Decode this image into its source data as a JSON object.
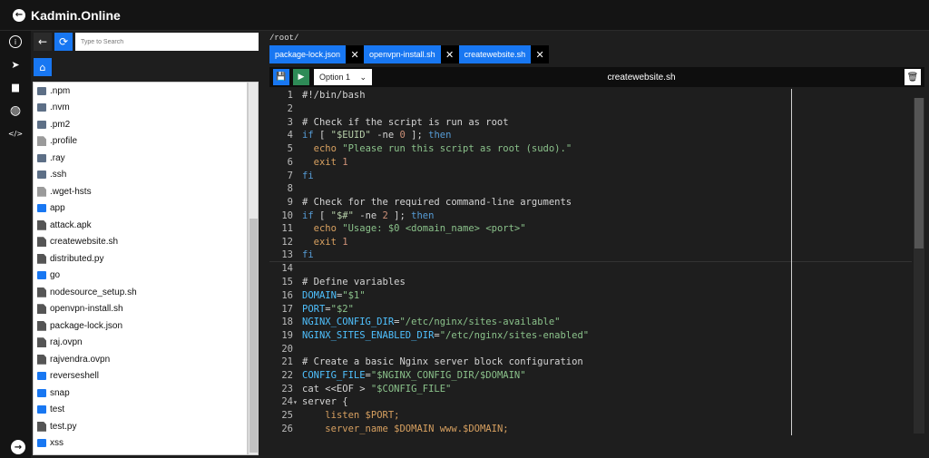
{
  "app": {
    "title": "Kadmin.Online"
  },
  "rail": {
    "icons": [
      "info-icon",
      "send-icon",
      "folder-icon",
      "globe-icon",
      "code-icon",
      "arrow-right-circle-icon"
    ],
    "info": "i",
    "send": "➤",
    "folder": "▆",
    "globe": "◍",
    "code": "</>",
    "bottom": "→"
  },
  "sidebar": {
    "back": "←",
    "refresh": "⟳",
    "search_placeholder": "Type to Search",
    "home": "⌂",
    "files": [
      {
        "name": ".npm",
        "type": "folder-hidden"
      },
      {
        "name": ".nvm",
        "type": "folder-hidden"
      },
      {
        "name": ".pm2",
        "type": "folder-hidden"
      },
      {
        "name": ".profile",
        "type": "file-hidden"
      },
      {
        "name": ".ray",
        "type": "folder-hidden"
      },
      {
        "name": ".ssh",
        "type": "folder-hidden"
      },
      {
        "name": ".wget-hsts",
        "type": "file-hidden"
      },
      {
        "name": "app",
        "type": "folder"
      },
      {
        "name": "attack.apk",
        "type": "file"
      },
      {
        "name": "createwebsite.sh",
        "type": "file"
      },
      {
        "name": "distributed.py",
        "type": "file"
      },
      {
        "name": "go",
        "type": "folder"
      },
      {
        "name": "nodesource_setup.sh",
        "type": "file"
      },
      {
        "name": "openvpn-install.sh",
        "type": "file"
      },
      {
        "name": "package-lock.json",
        "type": "file"
      },
      {
        "name": "raj.ovpn",
        "type": "file"
      },
      {
        "name": "rajvendra.ovpn",
        "type": "file"
      },
      {
        "name": "reverseshell",
        "type": "folder"
      },
      {
        "name": "snap",
        "type": "folder"
      },
      {
        "name": "test",
        "type": "folder"
      },
      {
        "name": "test.py",
        "type": "file"
      },
      {
        "name": "xss",
        "type": "folder"
      }
    ]
  },
  "editor": {
    "path": "/root/",
    "tabs": [
      {
        "label": "package-lock.json",
        "close": "✕"
      },
      {
        "label": "openvpn-install.sh",
        "close": "✕"
      },
      {
        "label": "createwebsite.sh",
        "close": "✕"
      }
    ],
    "save": "💾",
    "run": "▶",
    "select_value": "Option 1",
    "select_chevron": "⌄",
    "file_title": "createwebsite.sh",
    "trash": "🗑",
    "lines": [
      {
        "n": "1",
        "fold": "",
        "parts": [
          [
            "plain",
            "#!/bin/bash"
          ]
        ]
      },
      {
        "n": "2",
        "fold": "",
        "parts": []
      },
      {
        "n": "3",
        "fold": "",
        "parts": [
          [
            "cmt",
            "# Check if the script is run as root"
          ]
        ]
      },
      {
        "n": "4",
        "fold": "",
        "parts": [
          [
            "kw",
            "if"
          ],
          [
            "plain",
            " [ "
          ],
          [
            "str",
            "\"$EUID\""
          ],
          [
            "plain",
            " -ne "
          ],
          [
            "num",
            "0"
          ],
          [
            "plain",
            " ]; "
          ],
          [
            "kw",
            "then"
          ]
        ]
      },
      {
        "n": "5",
        "fold": "",
        "parts": [
          [
            "plain",
            "  "
          ],
          [
            "echo",
            "echo"
          ],
          [
            "plain",
            " "
          ],
          [
            "strg",
            "\"Please run this script as root (sudo).\""
          ]
        ]
      },
      {
        "n": "6",
        "fold": "",
        "parts": [
          [
            "plain",
            "  "
          ],
          [
            "echo",
            "exit"
          ],
          [
            "plain",
            " "
          ],
          [
            "num",
            "1"
          ]
        ]
      },
      {
        "n": "7",
        "fold": "",
        "parts": [
          [
            "kw",
            "fi"
          ]
        ]
      },
      {
        "n": "8",
        "fold": "",
        "parts": []
      },
      {
        "n": "9",
        "fold": "",
        "parts": [
          [
            "cmt",
            "# Check for the required command-line arguments"
          ]
        ]
      },
      {
        "n": "10",
        "fold": "",
        "parts": [
          [
            "kw",
            "if"
          ],
          [
            "plain",
            " [ "
          ],
          [
            "str",
            "\"$#\""
          ],
          [
            "plain",
            " -ne "
          ],
          [
            "num",
            "2"
          ],
          [
            "plain",
            " ]; "
          ],
          [
            "kw",
            "then"
          ]
        ]
      },
      {
        "n": "11",
        "fold": "",
        "parts": [
          [
            "plain",
            "  "
          ],
          [
            "echo",
            "echo"
          ],
          [
            "plain",
            " "
          ],
          [
            "strg",
            "\"Usage: $0 <domain_name> <port>\""
          ]
        ]
      },
      {
        "n": "12",
        "fold": "",
        "parts": [
          [
            "plain",
            "  "
          ],
          [
            "echo",
            "exit"
          ],
          [
            "plain",
            " "
          ],
          [
            "num",
            "1"
          ]
        ]
      },
      {
        "n": "13",
        "fold": "",
        "parts": [
          [
            "kw",
            "fi"
          ]
        ]
      },
      {
        "n": "14",
        "fold": "",
        "parts": []
      },
      {
        "n": "15",
        "fold": "",
        "parts": [
          [
            "cmt",
            "# Define variables"
          ]
        ]
      },
      {
        "n": "16",
        "fold": "",
        "parts": [
          [
            "var",
            "DOMAIN"
          ],
          [
            "plain",
            "="
          ],
          [
            "strg",
            "\"$1\""
          ]
        ]
      },
      {
        "n": "17",
        "fold": "",
        "parts": [
          [
            "var",
            "PORT"
          ],
          [
            "plain",
            "="
          ],
          [
            "strg",
            "\"$2\""
          ]
        ]
      },
      {
        "n": "18",
        "fold": "",
        "parts": [
          [
            "var",
            "NGINX_CONFIG_DIR"
          ],
          [
            "plain",
            "="
          ],
          [
            "strg",
            "\"/etc/nginx/sites-available\""
          ]
        ]
      },
      {
        "n": "19",
        "fold": "",
        "parts": [
          [
            "var",
            "NGINX_SITES_ENABLED_DIR"
          ],
          [
            "plain",
            "="
          ],
          [
            "strg",
            "\"/etc/nginx/sites-enabled\""
          ]
        ]
      },
      {
        "n": "20",
        "fold": "",
        "parts": []
      },
      {
        "n": "21",
        "fold": "",
        "parts": [
          [
            "cmt",
            "# Create a basic Nginx server block configuration"
          ]
        ]
      },
      {
        "n": "22",
        "fold": "",
        "parts": [
          [
            "var",
            "CONFIG_FILE"
          ],
          [
            "plain",
            "="
          ],
          [
            "strg",
            "\"$NGINX_CONFIG_DIR/$DOMAIN\""
          ]
        ]
      },
      {
        "n": "23",
        "fold": "",
        "parts": [
          [
            "plain",
            "cat <<EOF > "
          ],
          [
            "strg",
            "\"$CONFIG_FILE\""
          ]
        ]
      },
      {
        "n": "24",
        "fold": "▾",
        "parts": [
          [
            "plain",
            "server {"
          ]
        ]
      },
      {
        "n": "25",
        "fold": "",
        "parts": [
          [
            "plain",
            "    "
          ],
          [
            "echo",
            "listen $PORT;"
          ]
        ]
      },
      {
        "n": "26",
        "fold": "",
        "parts": [
          [
            "plain",
            "    "
          ],
          [
            "echo",
            "server_name $DOMAIN www.$DOMAIN;"
          ]
        ]
      }
    ],
    "active_line": "13"
  },
  "colors": {
    "accent": "#1877f2",
    "run": "#2e8b57",
    "background": "#1e1e1e",
    "bar": "#141414"
  }
}
